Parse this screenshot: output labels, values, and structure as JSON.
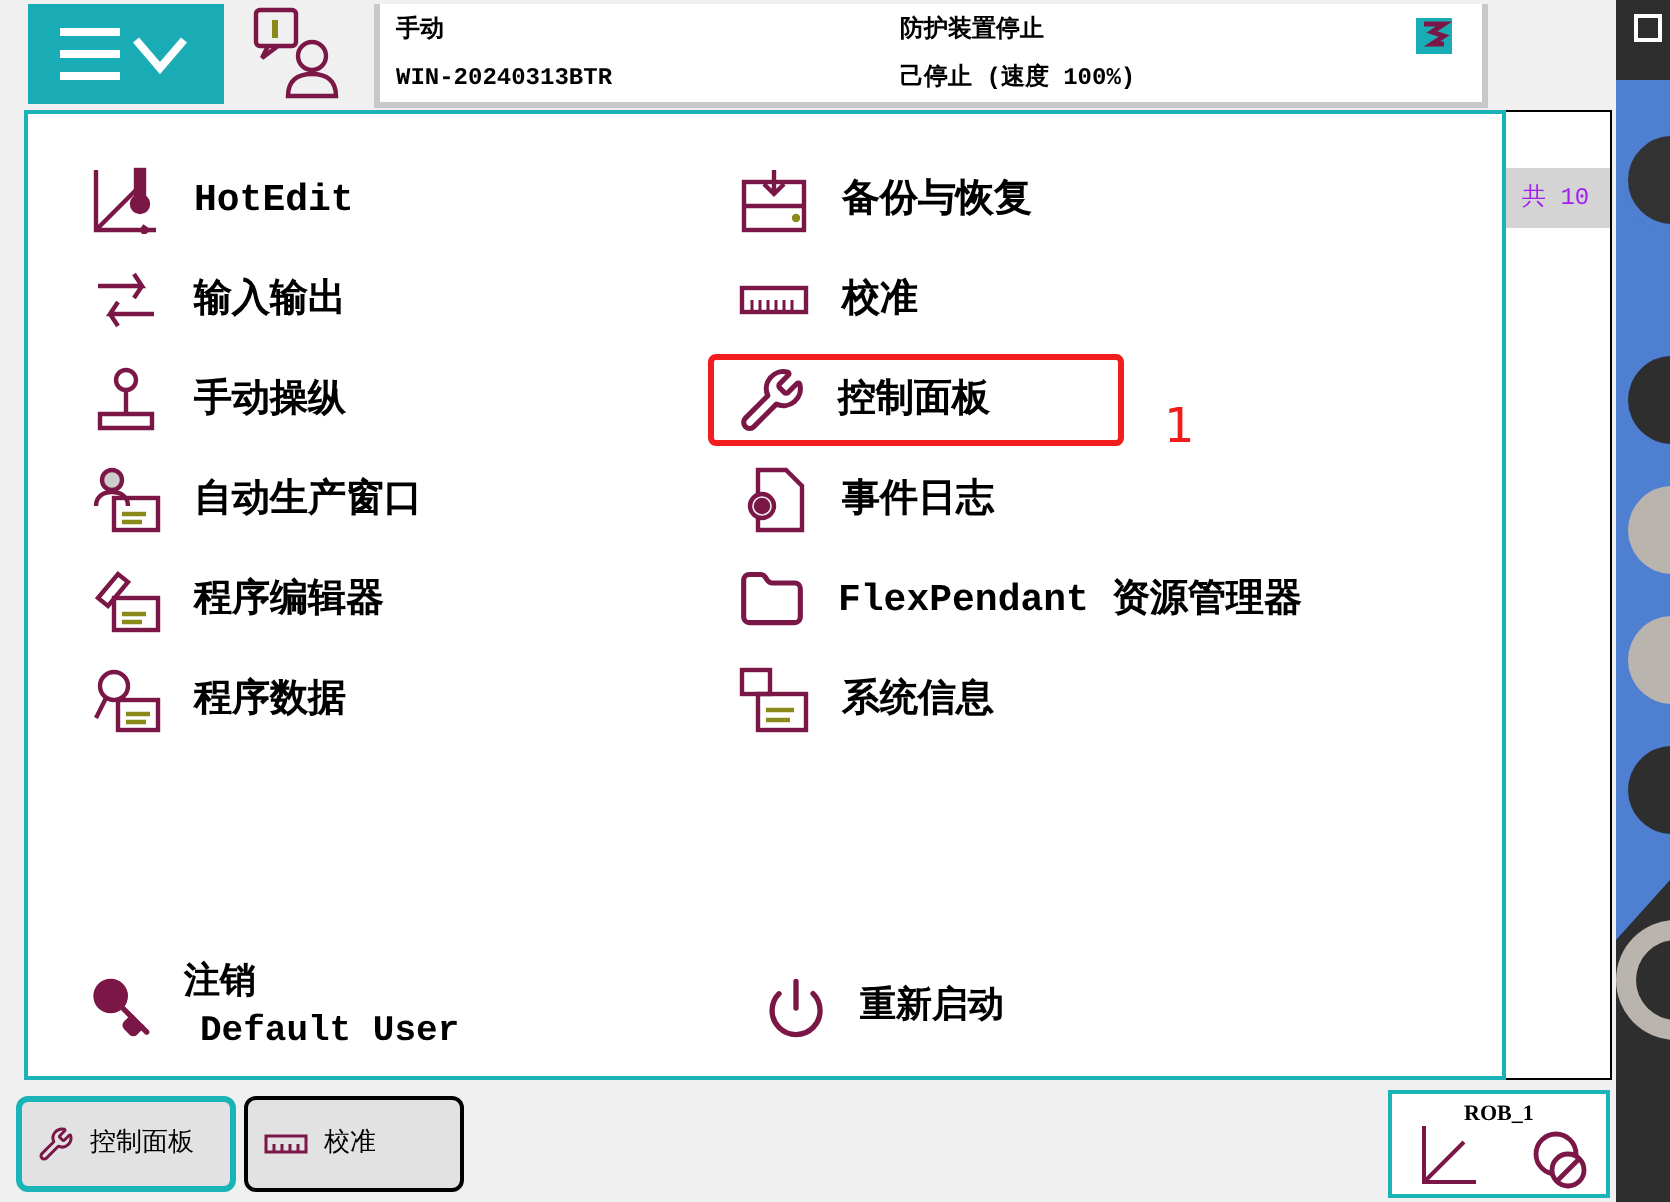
{
  "status": {
    "mode": "手动",
    "system": "WIN-20240313BTR",
    "guard": "防护装置停止",
    "state": "己停止 (速度 100%)"
  },
  "menu": {
    "left": [
      {
        "label": "HotEdit",
        "highlighted": false
      },
      {
        "label": "输入输出",
        "highlighted": false
      },
      {
        "label": "手动操纵",
        "highlighted": false
      },
      {
        "label": "自动生产窗口",
        "highlighted": false
      },
      {
        "label": "程序编辑器",
        "highlighted": false
      },
      {
        "label": "程序数据",
        "highlighted": false
      }
    ],
    "right": [
      {
        "label": "备份与恢复",
        "highlighted": false
      },
      {
        "label": "校准",
        "highlighted": false
      },
      {
        "label": "控制面板",
        "highlighted": true
      },
      {
        "label": "事件日志",
        "highlighted": false
      },
      {
        "label": "FlexPendant 资源管理器",
        "highlighted": false
      },
      {
        "label": "系统信息",
        "highlighted": false
      }
    ],
    "logout": {
      "label": "注销",
      "user": "Default User"
    },
    "restart": {
      "label": "重新启动"
    }
  },
  "annotation": "1",
  "background_window": {
    "tab_text": "共 10"
  },
  "taskbar": [
    {
      "label": "控制面板",
      "selected": true
    },
    {
      "label": "校准",
      "selected": false
    }
  ],
  "robot_status": {
    "label": "ROB_1"
  }
}
